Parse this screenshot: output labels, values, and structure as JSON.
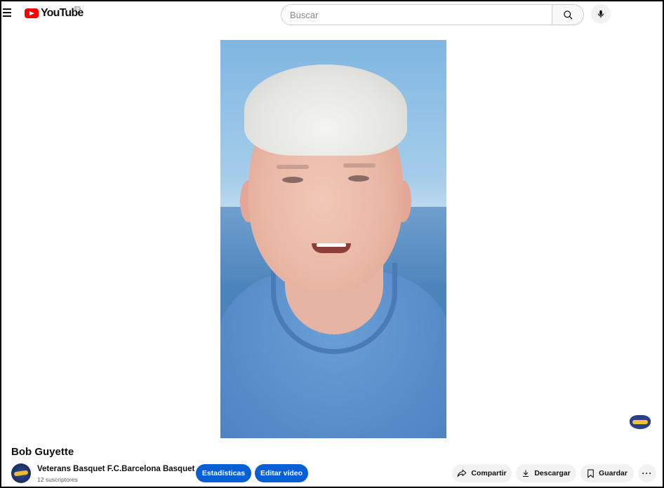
{
  "header": {
    "logo_text": "YouTube",
    "country_code": "ES",
    "search_placeholder": "Buscar"
  },
  "video": {
    "title": "Bob Guyette"
  },
  "channel": {
    "name": "Veterans Basquet F.C.Barcelona Basquet",
    "subscribers": "12 suscriptores"
  },
  "actions": {
    "stats": "Estadísticas",
    "edit": "Editar vídeo",
    "share": "Compartir",
    "download": "Descargar",
    "save": "Guardar"
  },
  "colors": {
    "accent": "#065fd4",
    "brand": "#ff0000"
  }
}
